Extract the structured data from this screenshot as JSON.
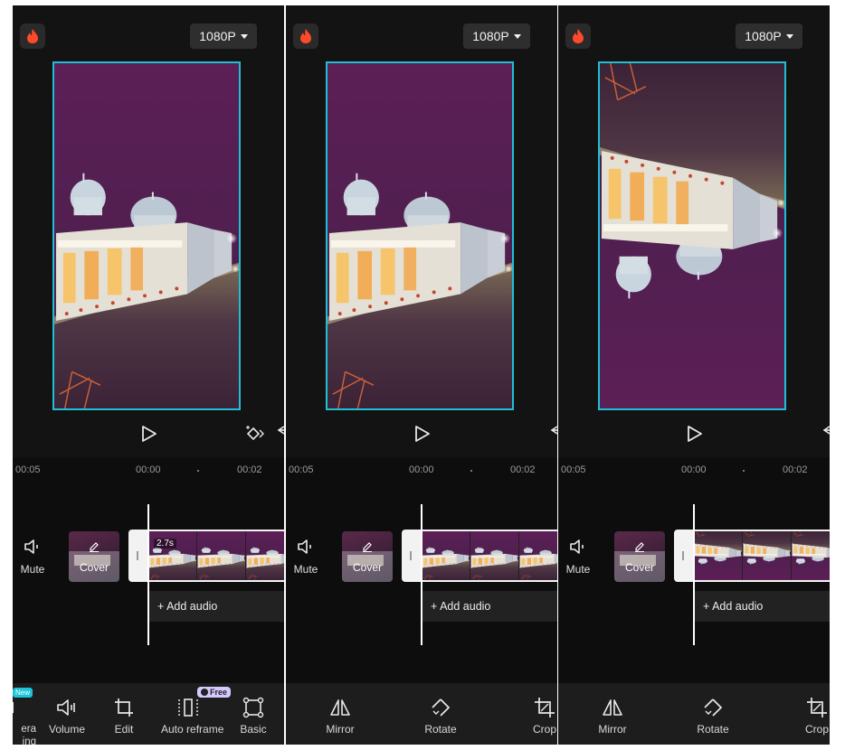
{
  "colors": {
    "accent_frame": "#1fbfd6",
    "panel_bg": "#151515",
    "timeline_bg": "#0d0d0d",
    "bottombar_bg": "#1d1d1d",
    "new_badge": "#1cc4d9",
    "free_badge": "#d6c9ff"
  },
  "panels": [
    {
      "resolution": "1080P",
      "image_orientation": "normal",
      "ruler": {
        "left_time": "00:05",
        "center_time": "00:00",
        "right_time": "00:02"
      },
      "mute_label": "Mute",
      "cover_label": "Cover",
      "clip_duration": "2.7s",
      "add_audio_label": "+ Add audio",
      "tools": [
        {
          "label": "era\ning",
          "icon": "camera-tracking-icon",
          "badge": "New"
        },
        {
          "label": "Volume",
          "icon": "volume-icon"
        },
        {
          "label": "Edit",
          "icon": "crop-icon"
        },
        {
          "label": "Auto reframe",
          "icon": "auto-reframe-icon",
          "badge": "Free"
        },
        {
          "label": "Basic",
          "icon": "basic-icon"
        }
      ]
    },
    {
      "resolution": "1080P",
      "image_orientation": "normal",
      "ruler": {
        "left_time": "00:05",
        "center_time": "00:00",
        "right_time": "00:02"
      },
      "mute_label": "Mute",
      "cover_label": "Cover",
      "clip_duration": "",
      "add_audio_label": "+ Add audio",
      "tools": [
        {
          "label": "Mirror",
          "icon": "mirror-icon"
        },
        {
          "label": "Rotate",
          "icon": "rotate-icon"
        },
        {
          "label": "Crop",
          "icon": "crop-icon"
        }
      ]
    },
    {
      "resolution": "1080P",
      "image_orientation": "flipped-vertical",
      "ruler": {
        "left_time": "00:05",
        "center_time": "00:00",
        "right_time": "00:02"
      },
      "mute_label": "Mute",
      "cover_label": "Cover",
      "clip_duration": "",
      "add_audio_label": "+ Add audio",
      "tools": [
        {
          "label": "Mirror",
          "icon": "mirror-icon"
        },
        {
          "label": "Rotate",
          "icon": "rotate-icon"
        },
        {
          "label": "Crop",
          "icon": "crop-icon"
        }
      ]
    }
  ]
}
